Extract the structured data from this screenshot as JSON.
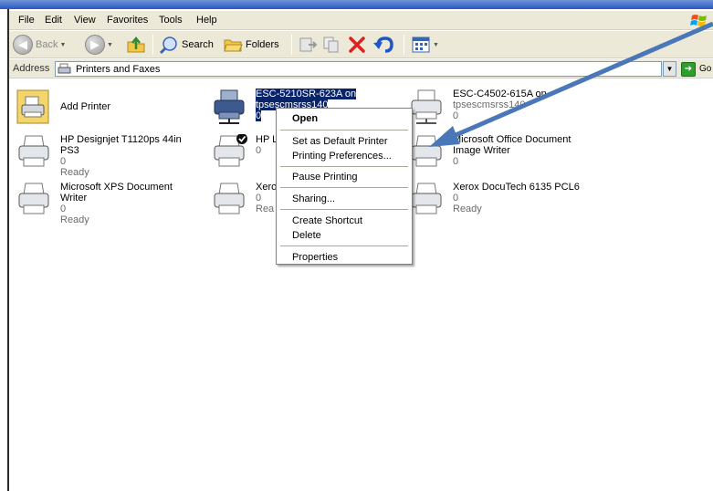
{
  "menubar": {
    "items": [
      {
        "label": "File"
      },
      {
        "label": "Edit"
      },
      {
        "label": "View"
      },
      {
        "label": "Favorites"
      },
      {
        "label": "Tools"
      },
      {
        "label": "Help"
      }
    ]
  },
  "toolbar": {
    "back_label": "Back",
    "search_label": "Search",
    "folders_label": "Folders"
  },
  "address": {
    "label": "Address",
    "value": "Printers and Faxes",
    "go_label": "Go"
  },
  "printers": [
    {
      "name": "Add Printer",
      "lines": []
    },
    {
      "name": "ESC-5210SR-623A on",
      "lines": [
        "tpsescmsrss140",
        "0"
      ],
      "selected": true
    },
    {
      "name": "ESC-C4502-615A on",
      "lines": [
        "tpsescmsrss140",
        "0"
      ]
    },
    {
      "name": "HP Designjet T1120ps 44in PS3",
      "lines": [
        "0",
        "Ready"
      ]
    },
    {
      "name": "HP L",
      "lines": [
        "0"
      ]
    },
    {
      "name": "Microsoft Office Document",
      "lines": [
        "Image Writer",
        "0"
      ]
    },
    {
      "name": "Microsoft XPS Document Writer",
      "lines": [
        "0",
        "Ready"
      ]
    },
    {
      "name": "Xero",
      "lines": [
        "0",
        "Rea"
      ]
    },
    {
      "name": "Xerox DocuTech 6135 PCL6",
      "lines": [
        "0",
        "Ready"
      ]
    }
  ],
  "context_menu": {
    "items": [
      {
        "label": "Open"
      },
      {
        "label": "Set as Default Printer"
      },
      {
        "label": "Printing Preferences..."
      },
      {
        "label": "Pause Printing"
      },
      {
        "label": "Sharing..."
      },
      {
        "label": "Create Shortcut"
      },
      {
        "label": "Delete"
      },
      {
        "label": "Properties"
      }
    ]
  },
  "colors": {
    "accent_arrow": "#4a77b8",
    "selection": "#0a246a",
    "chrome": "#ece9d8"
  }
}
